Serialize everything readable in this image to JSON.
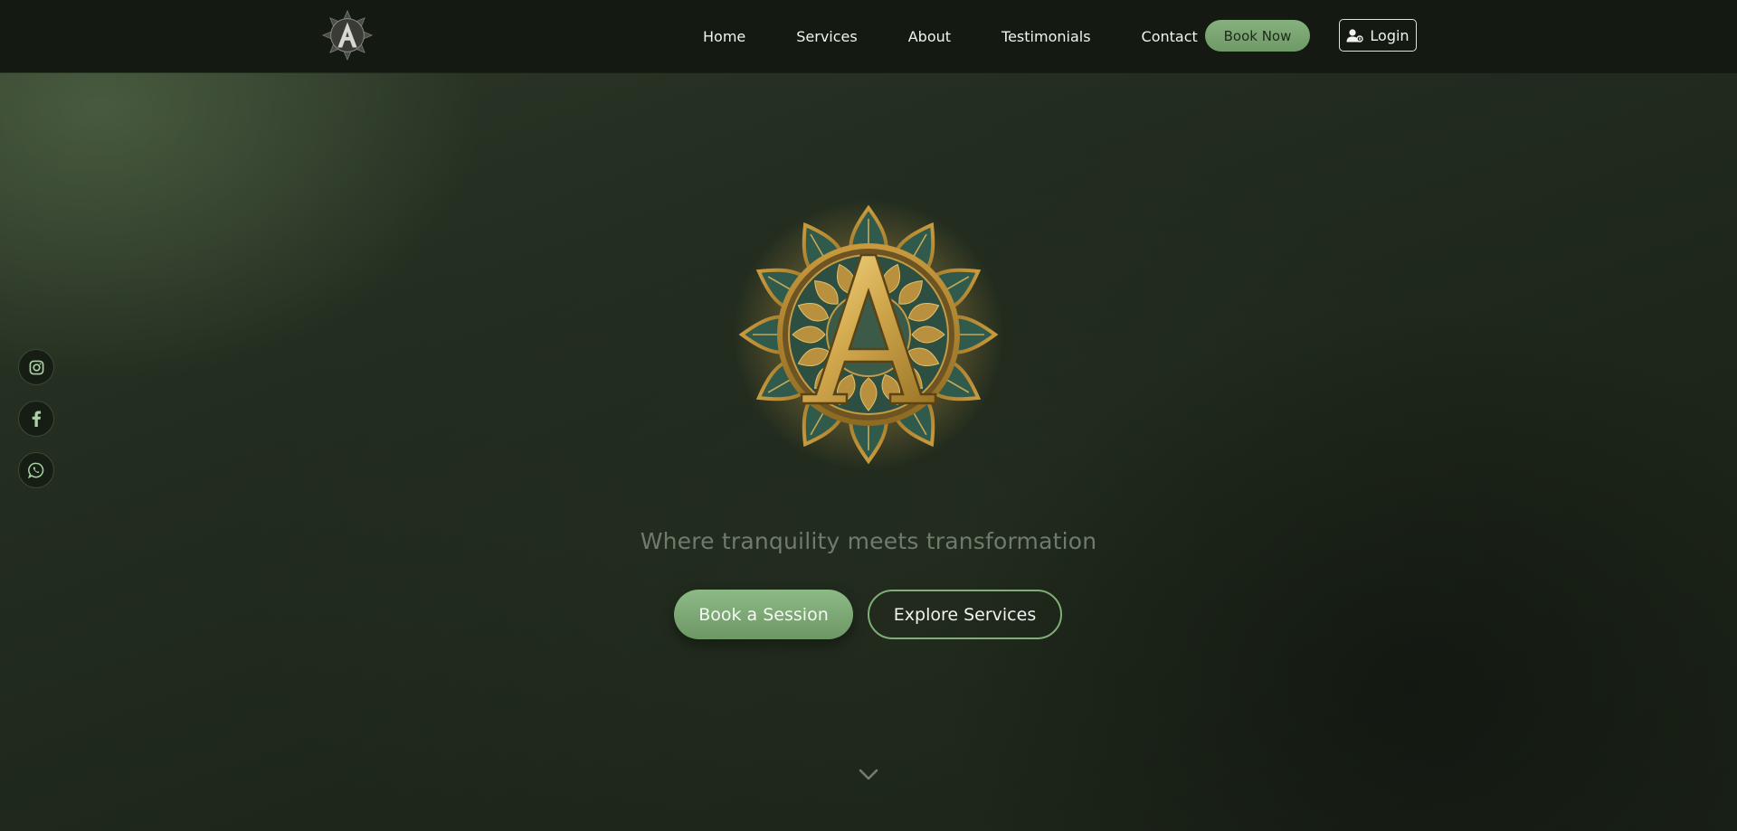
{
  "header": {
    "nav": [
      {
        "label": "Home"
      },
      {
        "label": "Services"
      },
      {
        "label": "About"
      },
      {
        "label": "Testimonials"
      },
      {
        "label": "Contact"
      }
    ],
    "book_now_label": "Book Now",
    "login_label": "Login",
    "logo_icon": "letter-a-mandala-logo",
    "user_icon": "user-icon"
  },
  "social": [
    {
      "icon": "instagram-icon"
    },
    {
      "icon": "facebook-icon"
    },
    {
      "icon": "whatsapp-icon"
    }
  ],
  "hero": {
    "emblem_icon": "gold-letter-a-mandala-emblem",
    "tagline": "Where tranquility meets transformation",
    "primary_cta": "Book a Session",
    "secondary_cta": "Explore Services",
    "scroll_icon": "chevron-down-icon"
  },
  "colors": {
    "accent_green": "#7fae77",
    "header_bg": "#141a12",
    "gold": "#c9a24a"
  }
}
